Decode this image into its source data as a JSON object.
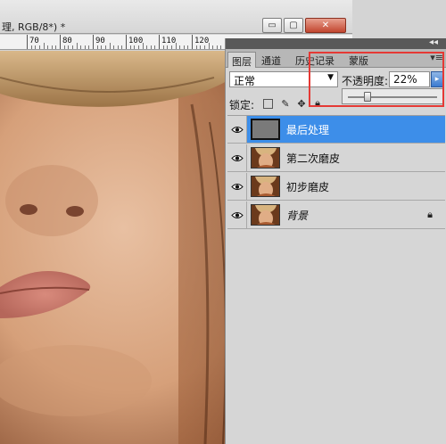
{
  "document": {
    "title": "理, RGB/8*) *",
    "window_buttons": {
      "minimize": "▭",
      "maximize": "▢",
      "close": "✕"
    },
    "ruler_labels": [
      "70",
      "80",
      "90",
      "100",
      "110",
      "120"
    ]
  },
  "layers_panel": {
    "tabs": [
      {
        "label": "图层",
        "active": true
      },
      {
        "label": "通道",
        "active": false
      },
      {
        "label": "历史记录",
        "active": false
      },
      {
        "label": "蒙版",
        "active": false
      }
    ],
    "blend_mode": "正常",
    "opacity_label": "不透明度:",
    "opacity_value": "22%",
    "opacity_fraction": 0.22,
    "lock_label": "锁定:",
    "lock_icons": [
      "lock-transparent-icon",
      "lock-brush-icon",
      "lock-move-icon",
      "lock-all-icon"
    ],
    "layers": [
      {
        "name": "最后处理",
        "selected": true,
        "thumb": "gray",
        "italic": false,
        "locked": false
      },
      {
        "name": "第二次磨皮",
        "selected": false,
        "thumb": "photo",
        "italic": false,
        "locked": false
      },
      {
        "name": "初步磨皮",
        "selected": false,
        "thumb": "photo",
        "italic": false,
        "locked": false
      },
      {
        "name": "背景",
        "selected": false,
        "thumb": "photo",
        "italic": true,
        "locked": true
      }
    ]
  },
  "colors": {
    "selection_blue": "#3d8ee9",
    "highlight_red": "#e53935",
    "panel_gray": "#d6d6d6"
  }
}
